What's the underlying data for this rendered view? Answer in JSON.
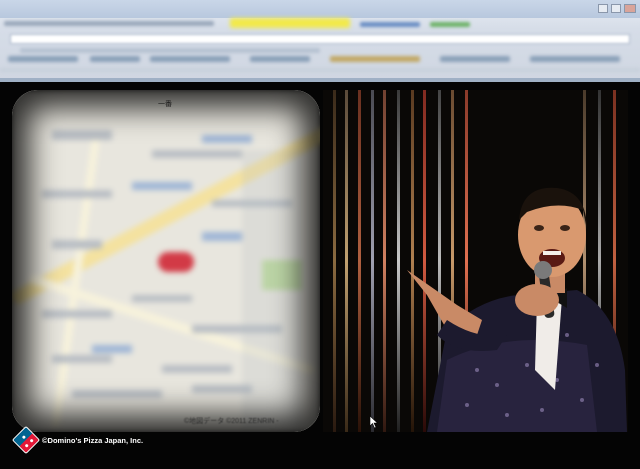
{
  "browser": {
    "chrome_colors": {
      "accent_tab": "#f2e94a",
      "frame": "#cfd6e1"
    }
  },
  "map": {
    "top_label": "一番",
    "copyright": "©地図データ ©2011 ZENRIN -"
  },
  "video": {
    "subject": "performer-in-tuxedo"
  },
  "footer": {
    "copyright": "©Domino's Pizza Japan, Inc.",
    "logo_icon": "dominos-logo-icon"
  },
  "colors": {
    "background": "#000000",
    "brand_blue": "#006491",
    "brand_red": "#e31837"
  }
}
